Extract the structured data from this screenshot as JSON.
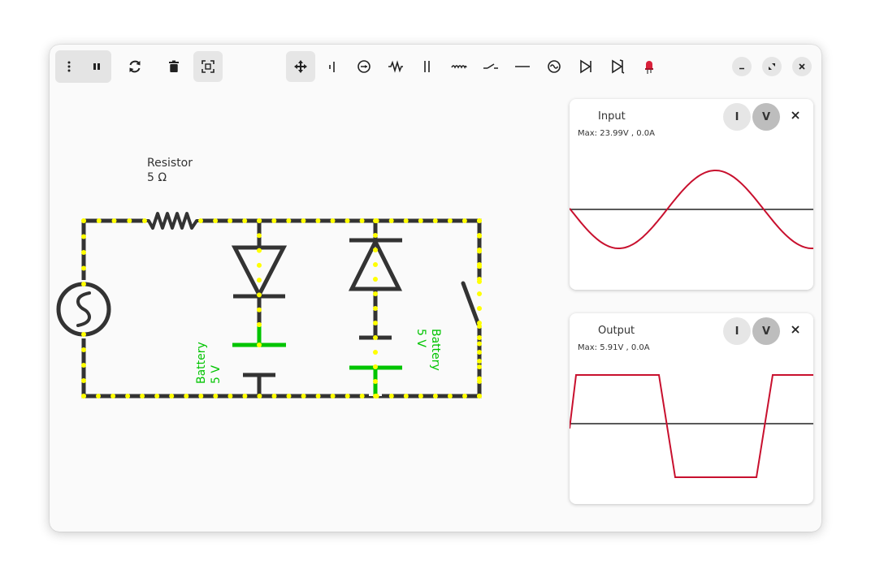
{
  "toolbar": {
    "left": [
      {
        "name": "menu-button",
        "icon": "vertical-dots-icon"
      },
      {
        "name": "pause-button",
        "icon": "pause-icon"
      },
      {
        "name": "refresh-button",
        "icon": "refresh-icon"
      },
      {
        "name": "delete-button",
        "icon": "trash-icon"
      },
      {
        "name": "fit-view-button",
        "icon": "fit-screen-icon"
      }
    ],
    "components": [
      {
        "name": "move-tool",
        "icon": "move-arrows-icon"
      },
      {
        "name": "battery-tool",
        "icon": "battery-icon"
      },
      {
        "name": "current-source-tool",
        "icon": "current-source-icon"
      },
      {
        "name": "resistor-tool",
        "icon": "resistor-icon"
      },
      {
        "name": "capacitor-tool",
        "icon": "capacitor-icon"
      },
      {
        "name": "inductor-tool",
        "icon": "inductor-icon"
      },
      {
        "name": "switch-tool",
        "icon": "switch-icon"
      },
      {
        "name": "wire-tool",
        "icon": "wire-icon"
      },
      {
        "name": "ac-source-tool",
        "icon": "ac-source-icon"
      },
      {
        "name": "diode-tool",
        "icon": "diode-icon"
      },
      {
        "name": "zener-diode-tool",
        "icon": "zener-diode-icon"
      },
      {
        "name": "led-tool",
        "icon": "led-icon"
      }
    ],
    "window_controls": [
      "minimize-icon",
      "maximize-icon",
      "close-icon"
    ]
  },
  "circuit": {
    "resistor": {
      "name": "Resistor",
      "value": "5 Ω"
    },
    "battery_left": {
      "name": "Battery",
      "value": "5 V"
    },
    "battery_right": {
      "name": "Battery",
      "value": "5 V"
    },
    "colors": {
      "wire": "#333333",
      "current_dots": "#ffff00",
      "battery": "#00c400",
      "led": "#d9203a"
    }
  },
  "panels": {
    "input": {
      "title": "Input",
      "max_text": "Max: 23.99V , 0.0A",
      "btn_i": "I",
      "btn_v": "V",
      "active_mode": "V",
      "trace_color": "#c8102e"
    },
    "output": {
      "title": "Output",
      "max_text": "Max: 5.91V , 0.0A",
      "btn_i": "I",
      "btn_v": "V",
      "active_mode": "V",
      "trace_color": "#c8102e"
    }
  }
}
